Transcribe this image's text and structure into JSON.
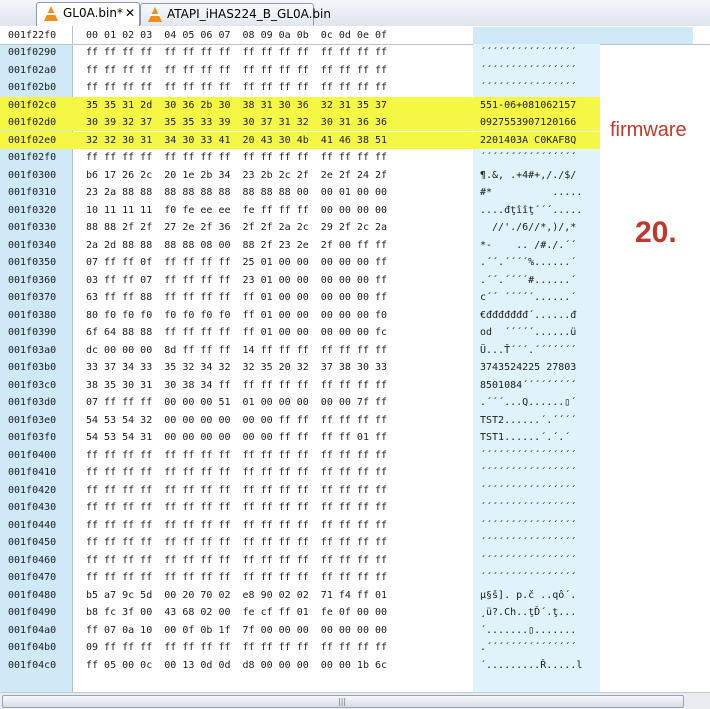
{
  "tabs": [
    {
      "label": "GL0A.bin*",
      "close": "✕"
    },
    {
      "label": "ATAPI_iHAS224_B_GL0A.bin"
    }
  ],
  "header": {
    "offset": "001f22f0",
    "columns": "00 01 02 03  04 05 06 07  08 09 0a 0b  0c 0d 0e 0f",
    "ascii": "´´´´´´´´´´´´´´´´"
  },
  "rows": [
    {
      "addr": "001f0290",
      "hex": "ff ff ff ff  ff ff ff ff  ff ff ff ff  ff ff ff ff",
      "ascii": "´´´´´´´´´´´´´´´´",
      "hl": false
    },
    {
      "addr": "001f02a0",
      "hex": "ff ff ff ff  ff ff ff ff  ff ff ff ff  ff ff ff ff",
      "ascii": "´´´´´´´´´´´´´´´´",
      "hl": false
    },
    {
      "addr": "001f02b0",
      "hex": "ff ff ff ff  ff ff ff ff  ff ff ff ff  ff ff ff ff",
      "ascii": "´´´´´´´´´´´´´´´´",
      "hl": false
    },
    {
      "addr": "001f02c0",
      "hex": "35 35 31 2d  30 36 2b 30  38 31 30 36  32 31 35 37",
      "ascii": "551-06+081062157",
      "hl": true
    },
    {
      "addr": "001f02d0",
      "hex": "30 39 32 37  35 35 33 39  30 37 31 32  30 31 36 36",
      "ascii": "0927553907120166",
      "hl": true
    },
    {
      "addr": "001f02e0",
      "hex": "32 32 30 31  34 30 33 41  20 43 30 4b  41 46 38 51",
      "ascii": "2201403A C0KAF8Q",
      "hl": true
    },
    {
      "addr": "001f02f0",
      "hex": "ff ff ff ff  ff ff ff ff  ff ff ff ff  ff ff ff ff",
      "ascii": "´´´´´´´´´´´´´´´´",
      "hl": false
    },
    {
      "addr": "001f0300",
      "hex": "b6 17 26 2c  20 1e 2b 34  23 2b 2c 2f  2e 2f 24 2f",
      "ascii": "¶.&, .+4#+,/./$/",
      "hl": false
    },
    {
      "addr": "001f0310",
      "hex": "23 2a 88 88  88 88 88 88  88 88 88 00  00 01 00 00",
      "ascii": "#*          .....",
      "hl": false
    },
    {
      "addr": "001f0320",
      "hex": "10 11 11 11  f0 fe ee ee  fe ff ff ff  00 00 00 00",
      "ascii": "....đţîîţ´´´.....",
      "hl": false
    },
    {
      "addr": "001f0330",
      "hex": "88 88 2f 2f  27 2e 2f 36  2f 2f 2a 2c  29 2f 2c 2a",
      "ascii": "  //'./6//*,)/,*",
      "hl": false
    },
    {
      "addr": "001f0340",
      "hl": false,
      "hex": "2a 2d 88 88  88 88 08 00  88 2f 23 2e  2f 00 ff ff",
      "ascii": "*-    .. /#./.´´"
    },
    {
      "addr": "001f0350",
      "hex": "07 ff ff 0f  ff ff ff ff  25 01 00 00  00 00 00 ff",
      "ascii": ".´´.´´´´%......´",
      "hl": false
    },
    {
      "addr": "001f0360",
      "hex": "03 ff ff 07  ff ff ff ff  23 01 00 00  00 00 00 ff",
      "ascii": ".´´.´´´´#......´",
      "hl": false
    },
    {
      "addr": "001f0370",
      "hex": "63 ff ff 88  ff ff ff ff  ff 01 00 00  00 00 00 ff",
      "ascii": "c´´ ´´´´´......´",
      "hl": false
    },
    {
      "addr": "001f0380",
      "hex": "80 f0 f0 f0  f0 f0 f0 f0  ff 01 00 00  00 00 00 f0",
      "ascii": "€đđđđđđđ´......đ",
      "hl": false
    },
    {
      "addr": "001f0390",
      "hex": "6f 64 88 88  ff ff ff ff  ff 01 00 00  00 00 00 fc",
      "ascii": "od  ´´´´´......ü",
      "hl": false
    },
    {
      "addr": "001f03a0",
      "hex": "dc 00 00 00  8d ff ff ff  14 ff ff ff  ff ff ff ff",
      "ascii": "Ü...Ť´´´.´´´´´´´",
      "hl": false
    },
    {
      "addr": "001f03b0",
      "hex": "33 37 34 33  35 32 34 32  32 35 20 32  37 38 30 33",
      "ascii": "3743524225 27803",
      "hl": false
    },
    {
      "addr": "001f03c0",
      "hex": "38 35 30 31  30 38 34 ff  ff ff ff ff  ff ff ff ff",
      "ascii": "8501084´´´´´´´´´",
      "hl": false
    },
    {
      "addr": "001f03d0",
      "hex": "07 ff ff ff  00 00 00 51  01 00 00 00  00 00 7f ff",
      "ascii": ".´´´...Q......▯´",
      "hl": false
    },
    {
      "addr": "001f03e0",
      "hex": "54 53 54 32  00 00 00 00  00 00 ff ff  ff ff ff ff",
      "ascii": "TST2......´.´´´´",
      "hl": false
    },
    {
      "addr": "001f03f0",
      "hex": "54 53 54 31  00 00 00 00  00 00 ff ff  ff ff 01 ff",
      "ascii": "TST1......´.´.´",
      "hl": false
    },
    {
      "addr": "001f0400",
      "hex": "ff ff ff ff  ff ff ff ff  ff ff ff ff  ff ff ff ff",
      "ascii": "´´´´´´´´´´´´´´´´",
      "hl": false
    },
    {
      "addr": "001f0410",
      "hex": "ff ff ff ff  ff ff ff ff  ff ff ff ff  ff ff ff ff",
      "ascii": "´´´´´´´´´´´´´´´´",
      "hl": false
    },
    {
      "addr": "001f0420",
      "hex": "ff ff ff ff  ff ff ff ff  ff ff ff ff  ff ff ff ff",
      "ascii": "´´´´´´´´´´´´´´´´",
      "hl": false
    },
    {
      "addr": "001f0430",
      "hex": "ff ff ff ff  ff ff ff ff  ff ff ff ff  ff ff ff ff",
      "ascii": "´´´´´´´´´´´´´´´´",
      "hl": false
    },
    {
      "addr": "001f0440",
      "hex": "ff ff ff ff  ff ff ff ff  ff ff ff ff  ff ff ff ff",
      "ascii": "´´´´´´´´´´´´´´´´",
      "hl": false
    },
    {
      "addr": "001f0450",
      "hex": "ff ff ff ff  ff ff ff ff  ff ff ff ff  ff ff ff ff",
      "ascii": "´´´´´´´´´´´´´´´´",
      "hl": false
    },
    {
      "addr": "001f0460",
      "hex": "ff ff ff ff  ff ff ff ff  ff ff ff ff  ff ff ff ff",
      "ascii": "´´´´´´´´´´´´´´´´",
      "hl": false
    },
    {
      "addr": "001f0470",
      "hex": "ff ff ff ff  ff ff ff ff  ff ff ff ff  ff ff ff ff",
      "ascii": "´´´´´´´´´´´´´´´´",
      "hl": false
    },
    {
      "addr": "001f0480",
      "hex": "b5 a7 9c 5d  00 20 70 02  e8 90 02 02  71 f4 ff 01",
      "ascii": "µ§š]. p.č ..qô´.",
      "hl": false
    },
    {
      "addr": "001f0490",
      "hex": "b8 fc 3f 00  43 68 02 00  fe cf ff 01  fe 0f 00 00",
      "ascii": "¸ü?.Ch..ţĎ´.ţ...",
      "hl": false
    },
    {
      "addr": "001f04a0",
      "hex": "ff 07 0a 10  00 0f 0b 1f  7f 00 00 00  00 00 00 00",
      "ascii": "´.......▯.......",
      "hl": false
    },
    {
      "addr": "001f04b0",
      "hex": "09 ff ff ff  ff ff ff ff  ff ff ff ff  ff ff ff ff",
      "ascii": ".´´´´´´´´´´´´´´´",
      "hl": false
    },
    {
      "addr": "001f04c0",
      "hex": "ff 05 00 0c  00 13 0d 0d  d8 00 00 00  00 00 1b 6c",
      "ascii": "´.........Ř.....l",
      "hl": false
    }
  ],
  "annotations": {
    "firmware": "firmware",
    "number": "20."
  },
  "colors": {
    "highlight": "#f4f744",
    "address_column": "#cfeaf6",
    "annotation": "#c0392b"
  }
}
